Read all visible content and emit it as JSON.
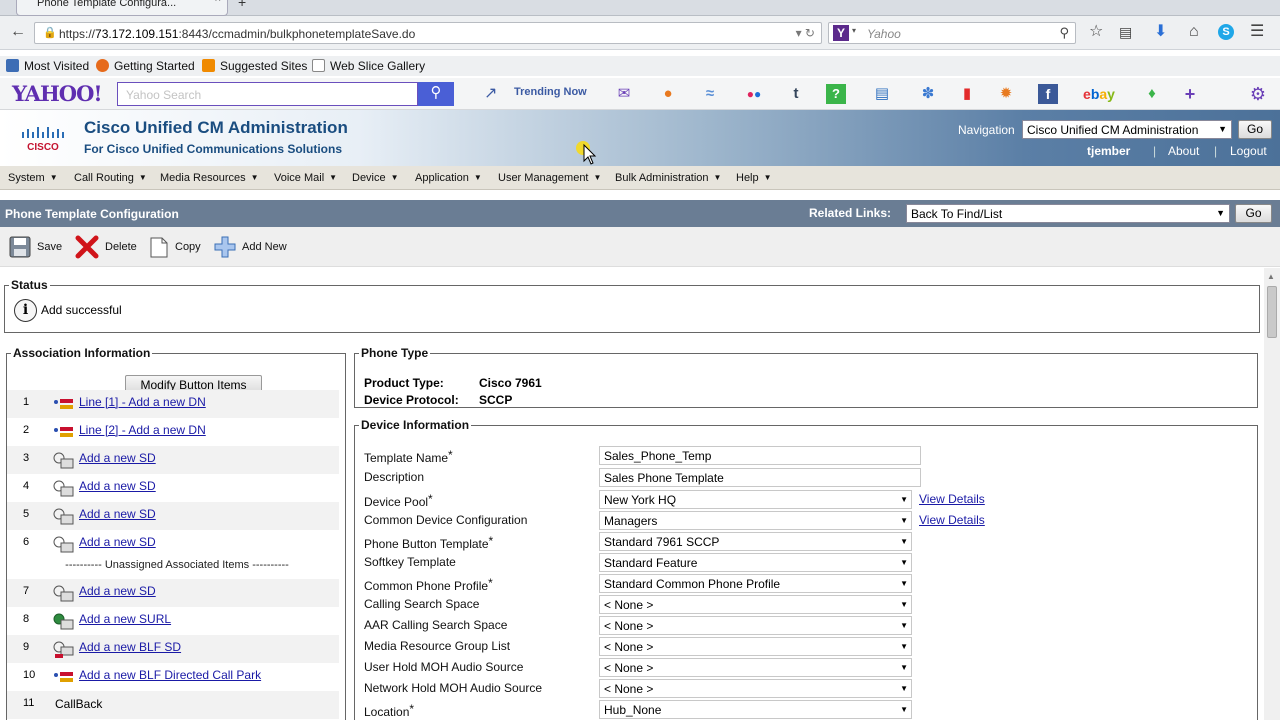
{
  "browser": {
    "tab_title": "Phone Template Configura...",
    "url_prefix": "https://",
    "url_host": "73.172.109.151",
    "url_rest": ":8443/ccmadmin/bulkphonetemplateSave.do",
    "search_engine": "Y",
    "search_placeholder": "Yahoo"
  },
  "bookmarks": [
    {
      "label": "Most Visited",
      "icon": "gear-icon",
      "color": "#3d6db5"
    },
    {
      "label": "Getting Started",
      "icon": "firefox-icon",
      "color": "#e66a1b"
    },
    {
      "label": "Suggested Sites",
      "icon": "sites-icon",
      "color": "#f08a00"
    },
    {
      "label": "Web Slice Gallery",
      "icon": "slice-icon",
      "color": "#ffffff"
    }
  ],
  "yahoo_toolbar": {
    "logo": "YAHOO!",
    "search_placeholder": "Yahoo Search",
    "trending": "Trending Now",
    "icons": [
      "mail",
      "sports",
      "finance",
      "flickr",
      "tumblr",
      "answers",
      "news",
      "weather",
      "bookmark",
      "settings",
      "facebook",
      "ebay",
      "shopping",
      "add",
      "gear"
    ]
  },
  "cisco": {
    "title": "Cisco Unified CM Administration",
    "subtitle": "For Cisco Unified Communications Solutions",
    "navigation_label": "Navigation",
    "navigation_value": "Cisco Unified CM Administration",
    "go": "Go",
    "user": "tjember",
    "about": "About",
    "logout": "Logout",
    "logo_text": "CISCO"
  },
  "menu": [
    "System",
    "Call Routing",
    "Media Resources",
    "Voice Mail",
    "Device",
    "Application",
    "User Management",
    "Bulk Administration",
    "Help"
  ],
  "page": {
    "title": "Phone Template Configuration",
    "related_links_label": "Related Links:",
    "related_links_value": "Back To Find/List",
    "go": "Go"
  },
  "toolbar": {
    "save": "Save",
    "delete": "Delete",
    "copy": "Copy",
    "add_new": "Add New"
  },
  "status": {
    "legend": "Status",
    "message": "Add successful"
  },
  "association": {
    "legend": "Association Information",
    "modify_button": "Modify Button Items",
    "unassigned_label": "---------- Unassigned Associated Items ----------",
    "rows": [
      {
        "num": "1",
        "label": "Line [1] - Add a new DN",
        "icon": "line-icon"
      },
      {
        "num": "2",
        "label": "Line [2] - Add a new DN",
        "icon": "line-icon"
      },
      {
        "num": "3",
        "label": "Add a new SD",
        "icon": "speed-dial-icon"
      },
      {
        "num": "4",
        "label": "Add a new SD",
        "icon": "speed-dial-icon"
      },
      {
        "num": "5",
        "label": "Add a new SD",
        "icon": "speed-dial-icon"
      },
      {
        "num": "6",
        "label": "Add a new SD",
        "icon": "speed-dial-icon"
      },
      {
        "num": "7",
        "label": "Add a new SD",
        "icon": "speed-dial-icon"
      },
      {
        "num": "8",
        "label": "Add a new SURL",
        "icon": "service-url-icon"
      },
      {
        "num": "9",
        "label": "Add a new BLF SD",
        "icon": "blf-icon"
      },
      {
        "num": "10",
        "label": "Add a new BLF Directed Call Park",
        "icon": "line-icon"
      },
      {
        "num": "11",
        "label": "CallBack",
        "icon": ""
      }
    ]
  },
  "phone_type": {
    "legend": "Phone Type",
    "product_type_label": "Product Type:",
    "product_type": "Cisco 7961",
    "protocol_label": "Device Protocol:",
    "protocol": "SCCP"
  },
  "device_info": {
    "legend": "Device Information",
    "view_details": "View Details",
    "fields": [
      {
        "label": "Template Name",
        "required": true,
        "kind": "input",
        "value": "Sales_Phone_Temp"
      },
      {
        "label": "Description",
        "required": false,
        "kind": "input",
        "value": "Sales Phone Template"
      },
      {
        "label": "Device Pool",
        "required": true,
        "kind": "select",
        "value": "New York HQ",
        "details": true
      },
      {
        "label": "Common Device Configuration",
        "required": false,
        "kind": "select",
        "value": "Managers",
        "details": true
      },
      {
        "label": "Phone Button Template",
        "required": true,
        "kind": "select",
        "value": "Standard 7961 SCCP"
      },
      {
        "label": "Softkey Template",
        "required": false,
        "kind": "select",
        "value": "Standard Feature"
      },
      {
        "label": "Common Phone Profile",
        "required": true,
        "kind": "select",
        "value": "Standard Common Phone Profile"
      },
      {
        "label": "Calling Search Space",
        "required": false,
        "kind": "select",
        "value": "< None >"
      },
      {
        "label": "AAR Calling Search Space",
        "required": false,
        "kind": "select",
        "value": "< None >"
      },
      {
        "label": "Media Resource Group List",
        "required": false,
        "kind": "select",
        "value": "< None >"
      },
      {
        "label": "User Hold MOH Audio Source",
        "required": false,
        "kind": "select",
        "value": "< None >"
      },
      {
        "label": "Network Hold MOH Audio Source",
        "required": false,
        "kind": "select",
        "value": "< None >"
      },
      {
        "label": "Location",
        "required": true,
        "kind": "select",
        "value": "Hub_None"
      }
    ]
  }
}
